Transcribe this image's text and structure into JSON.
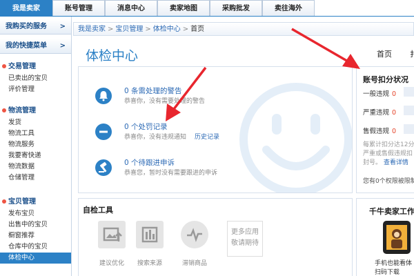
{
  "topnav": {
    "tabs": [
      {
        "label": "我是卖家"
      },
      {
        "label": "账号管理"
      },
      {
        "label": "消息中心"
      },
      {
        "label": "卖家地图"
      },
      {
        "label": "采购批发"
      },
      {
        "label": "卖往海外"
      }
    ]
  },
  "sidebar": {
    "headers": [
      {
        "label": "我购买的服务",
        "chevron": ">"
      },
      {
        "label": "我的快捷菜单",
        "chevron": ">"
      }
    ],
    "sections": [
      {
        "title": "交易管理",
        "items": [
          "已卖出的宝贝",
          "评价管理"
        ]
      },
      {
        "title": "物流管理",
        "items": [
          "发货",
          "物流工具",
          "物流服务",
          "我要寄快递",
          "物流数据",
          "仓储管理"
        ]
      },
      {
        "title": "宝贝管理",
        "items": [
          "发布宝贝",
          "出售中的宝贝",
          "橱窗推荐",
          "仓库中的宝贝",
          "体检中心"
        ]
      }
    ]
  },
  "breadcrumb": {
    "items": [
      "我是卖家",
      "宝贝管理",
      "体检中心"
    ],
    "sep": ">",
    "current": "首页"
  },
  "page": {
    "title": "体检中心",
    "tab_home": "首页",
    "tab_next": "扌"
  },
  "notices": [
    {
      "title": "0 条需处理的警告",
      "desc": "恭喜你，没有需要处理的警告",
      "icon": "bell-icon"
    },
    {
      "title": "0 个处罚记录",
      "desc": "恭喜你，没有违规通知",
      "link": "历史记录",
      "icon": "minus-circle-icon"
    },
    {
      "title": "0 个待跟进申诉",
      "desc": "恭喜您，暂时没有需要跟进的申诉",
      "icon": "gavel-icon"
    }
  ],
  "tools": {
    "title": "自检工具",
    "items": [
      {
        "label": "建议优化",
        "icon": "image-upload-icon"
      },
      {
        "label": "搜索来源",
        "icon": "bar-chart-icon"
      },
      {
        "label": "滞销商品",
        "icon": "pulse-icon"
      }
    ],
    "more": [
      "更多应用",
      "敬请期待"
    ]
  },
  "account": {
    "title": "账号扣分状况",
    "rows": [
      {
        "label": "一般违规",
        "value": "0"
      },
      {
        "label": "严重违规",
        "value": "0"
      },
      {
        "label": "售假违规",
        "value": "0"
      }
    ],
    "note_lines": [
      "每累计扣分达12分",
      "严重或售假违规扣",
      "封号。"
    ],
    "note_link": "查看详情",
    "footer": "您有0个权限被限制"
  },
  "qianniu": {
    "title": "千牛卖家工作",
    "lines": [
      "手机也能看体",
      "扫码下载"
    ]
  },
  "colors": {
    "accent": "#2c81c6",
    "link": "#2c6ab5",
    "alert": "#e5452b",
    "annotation": "#e8262e"
  }
}
